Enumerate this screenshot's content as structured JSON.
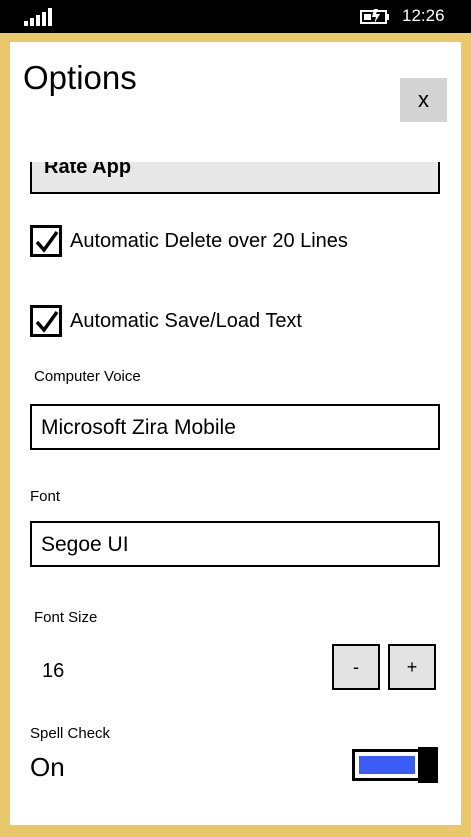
{
  "status_bar": {
    "time": "12:26",
    "signal_icon": "signal-icon",
    "battery_icon": "battery-charging-icon"
  },
  "dialog": {
    "title": "Options",
    "close_label": "x"
  },
  "rate_app": {
    "label": "Rate App"
  },
  "options": {
    "auto_delete": {
      "label": "Automatic Delete over 20 Lines",
      "checked": true
    },
    "auto_save": {
      "label": "Automatic Save/Load Text",
      "checked": true
    }
  },
  "computer_voice": {
    "label": "Computer Voice",
    "value": "Microsoft Zira Mobile"
  },
  "font": {
    "label": "Font",
    "value": "Segoe UI"
  },
  "font_size": {
    "label": "Font Size",
    "value": "16",
    "decrement_label": "-",
    "increment_label": "+"
  },
  "spell_check": {
    "label": "Spell Check",
    "state": "On",
    "on": true
  },
  "colors": {
    "frame": "#e9c76b",
    "toggle_fill": "#3c5cf6",
    "button_gray": "#d3d3d3"
  }
}
